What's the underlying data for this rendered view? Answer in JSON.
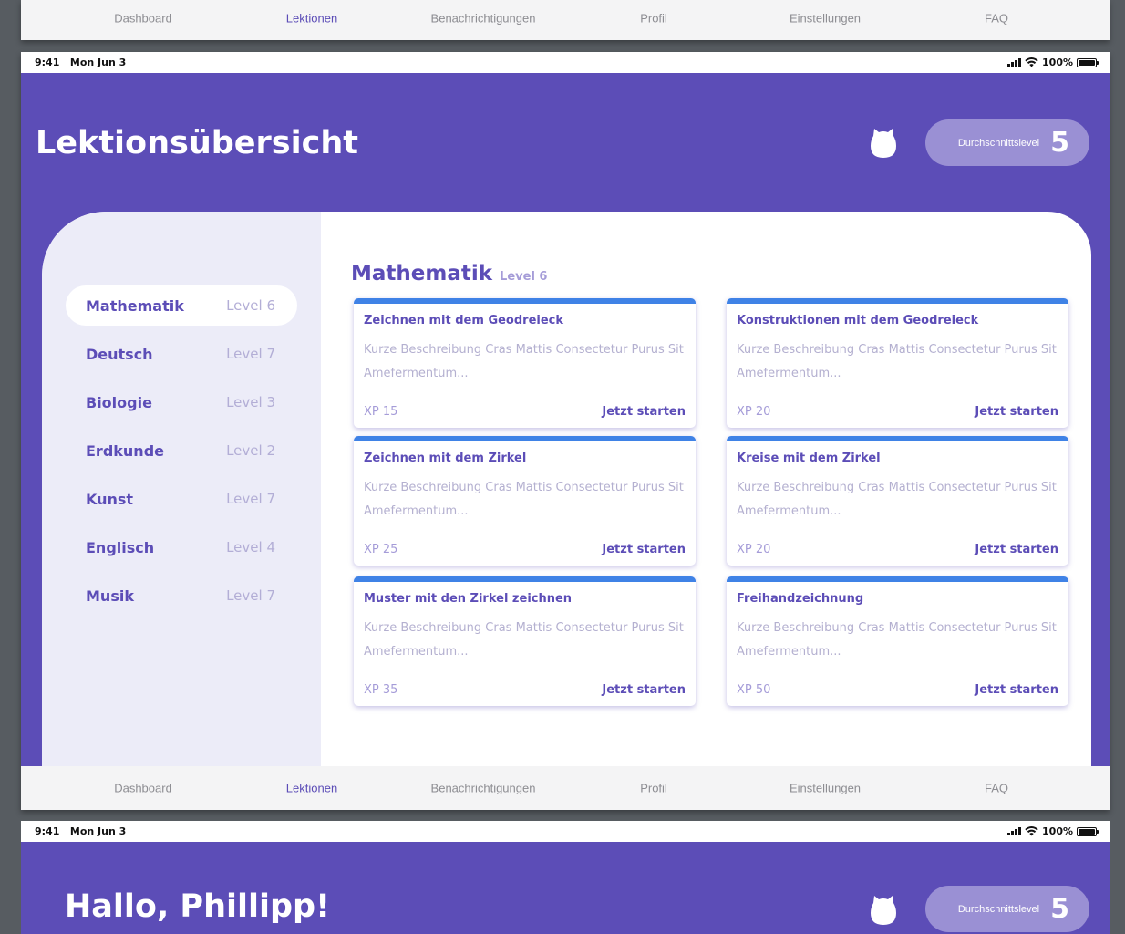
{
  "tabs": [
    {
      "label": "Dashboard",
      "active": false
    },
    {
      "label": "Lektionen",
      "active": true
    },
    {
      "label": "Benachrichtigungen",
      "active": false
    },
    {
      "label": "Profil",
      "active": false
    },
    {
      "label": "Einstellungen",
      "active": false
    },
    {
      "label": "FAQ",
      "active": false
    }
  ],
  "status": {
    "time": "9:41",
    "date": "Mon Jun 3",
    "battery": "100%"
  },
  "header": {
    "title": "Lektionsübersicht",
    "level_label": "Durchschnittslevel",
    "level_value": "5"
  },
  "subjects": [
    {
      "name": "Mathematik",
      "level": "Level 6",
      "active": true
    },
    {
      "name": "Deutsch",
      "level": "Level 7",
      "active": false
    },
    {
      "name": "Biologie",
      "level": "Level 3",
      "active": false
    },
    {
      "name": "Erdkunde",
      "level": "Level 2",
      "active": false
    },
    {
      "name": "Kunst",
      "level": "Level 7",
      "active": false
    },
    {
      "name": "Englisch",
      "level": "Level 4",
      "active": false
    },
    {
      "name": "Musik",
      "level": "Level 7",
      "active": false
    }
  ],
  "main": {
    "subject": "Mathematik",
    "level": "Level 6"
  },
  "lessons": [
    {
      "title": "Zeichnen mit dem Geodreieck",
      "desc": "Kurze Beschreibung Cras Mattis Consectetur Purus Sit Amefermentum...",
      "xp": "XP 15",
      "cta": "Jetzt starten"
    },
    {
      "title": "Konstruktionen mit dem Geodreieck",
      "desc": "Kurze Beschreibung Cras Mattis Consectetur Purus Sit Amefermentum...",
      "xp": "XP 20",
      "cta": "Jetzt starten"
    },
    {
      "title": "Zeichnen mit dem Zirkel",
      "desc": "Kurze Beschreibung Cras Mattis Consectetur Purus Sit Amefermentum...",
      "xp": "XP 25",
      "cta": "Jetzt starten"
    },
    {
      "title": "Kreise mit dem Zirkel",
      "desc": "Kurze Beschreibung Cras Mattis Consectetur Purus Sit Amefermentum...",
      "xp": "XP 20",
      "cta": "Jetzt starten"
    },
    {
      "title": "Muster mit den Zirkel zeichnen",
      "desc": "Kurze Beschreibung Cras Mattis Consectetur Purus Sit Amefermentum...",
      "xp": "XP 35",
      "cta": "Jetzt starten"
    },
    {
      "title": "Freihandzeichnung",
      "desc": "Kurze Beschreibung Cras Mattis Consectetur Purus Sit Amefermentum...",
      "xp": "XP 50",
      "cta": "Jetzt starten"
    }
  ],
  "next_screen": {
    "greeting": "Hallo, Phillipp!",
    "level_label": "Durchschnittslevel",
    "level_value": "5"
  },
  "colors": {
    "primary": "#5c4db7",
    "card_accent": "#3f82e6",
    "sidebar_bg": "#ececf8"
  },
  "icons": {
    "owl": "owl-mascot-icon",
    "signal": "cellular-signal-icon",
    "wifi": "wifi-icon",
    "battery": "battery-icon"
  }
}
